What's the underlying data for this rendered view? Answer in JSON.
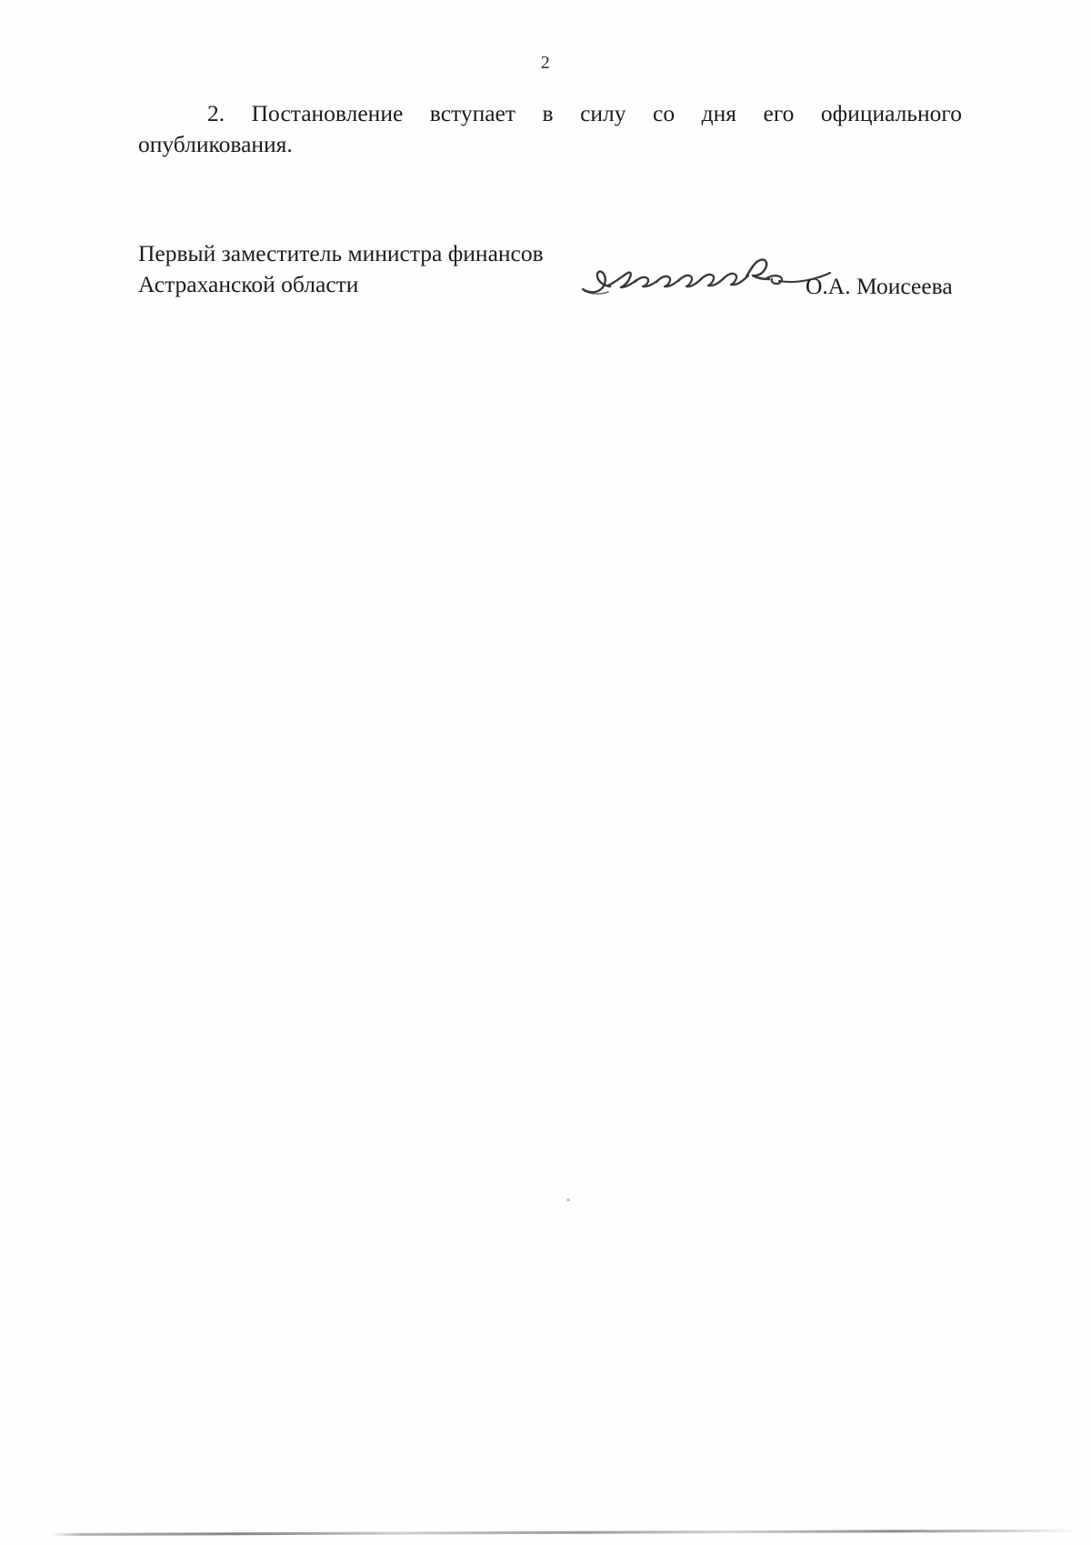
{
  "document": {
    "page_number": "2",
    "paragraph": {
      "line1": "2. Постановление вступает в силу со дня его официального",
      "line2": "опубликования.",
      "full_text": "2. Постановление вступает в силу со дня его официального опубликования."
    },
    "signature_block": {
      "title_line1": "Первый заместитель министра финансов",
      "title_line2": "Астраханской области",
      "signature_icon": "handwritten-signature-mark",
      "name": "О.А. Моисеева"
    },
    "artifacts": {
      "edge_line": "scan-edge-line",
      "speck": "scan-speck"
    },
    "colors": {
      "page_background": "#fefefe",
      "ink": "#1c1c1c",
      "page_number_ink": "#2b2b2b",
      "signature_ink": "#3a3a3a",
      "artifact": "#8c8c8c"
    }
  }
}
